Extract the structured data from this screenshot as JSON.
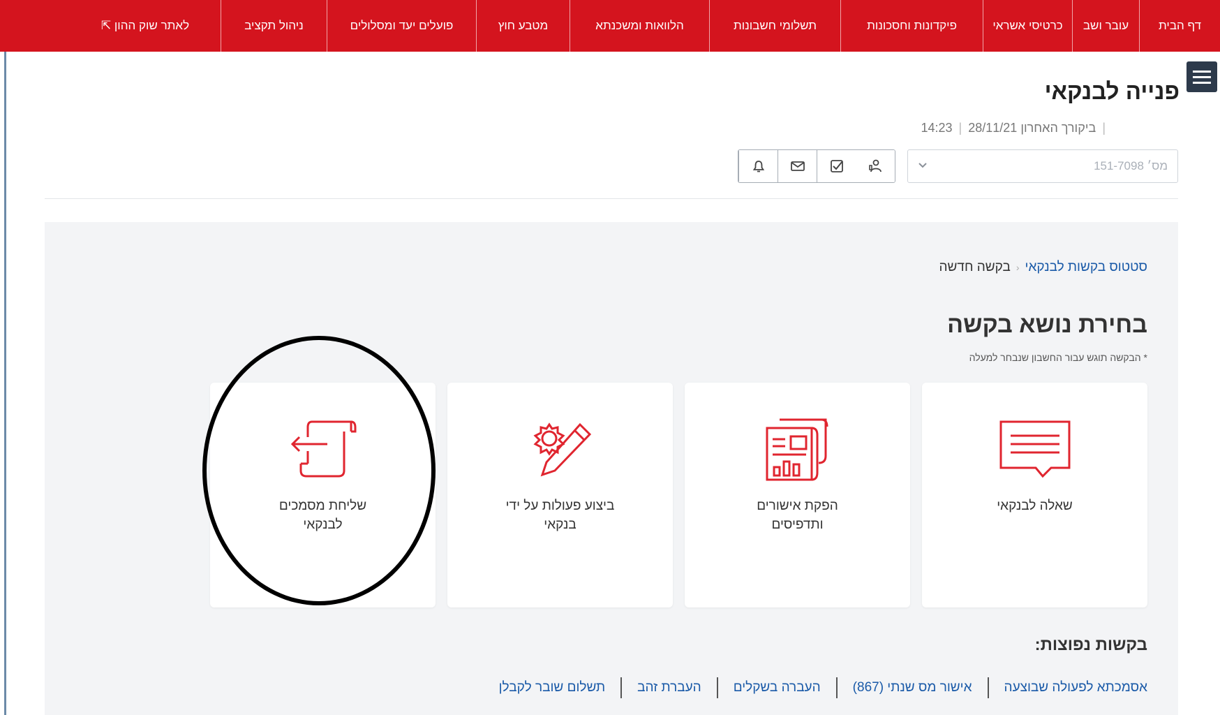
{
  "nav": {
    "items": [
      {
        "label": "דף הבית"
      },
      {
        "label": "עובר ושב"
      },
      {
        "label": "כרטיסי אשראי"
      },
      {
        "label": "פיקדונות וחסכונות"
      },
      {
        "label": "תשלומי חשבונות"
      },
      {
        "label": "הלוואות ומשכנתא"
      },
      {
        "label": "מטבע חוץ"
      },
      {
        "label": "פועלים יעד ומסלולים"
      },
      {
        "label": "ניהול תקציב"
      },
      {
        "label": "לאתר שוק ההון ⇱"
      }
    ]
  },
  "header": {
    "title": "פנייה לבנקאי",
    "last_visit_label": "ביקורך האחרון",
    "last_visit_date": "28/11/21",
    "last_visit_time": "14:23",
    "account_placeholder": "מס׳ 151-7098"
  },
  "icons": {
    "menu": "hamburger-icon",
    "chevron": "chevron-down-icon",
    "bell": "bell-icon",
    "mail": "mail-icon",
    "tasks": "checkbox-icon",
    "advisor": "person-icon"
  },
  "breadcrumb": {
    "parent": "סטטוס בקשות לבנקאי",
    "current": "בקשה חדשה"
  },
  "section": {
    "title": "בחירת נושא בקשה",
    "note": "* הבקשה תוגש עבור החשבון שנבחר למעלה"
  },
  "cards": [
    {
      "label": "שאלה לבנקאי",
      "icon": "chat-message-icon"
    },
    {
      "label": "הפקת אישורים ותדפיסים",
      "icon": "reports-document-icon"
    },
    {
      "label": "ביצוע פעולות על ידי בנקאי",
      "icon": "gear-pencil-icon"
    },
    {
      "label": "שליחת מסמכים לבנקאי",
      "icon": "send-document-icon"
    }
  ],
  "popular": {
    "title": "בקשות נפוצות:",
    "links": [
      "אסמכתא לפעולה שבוצעה",
      "אישור מס שנתי (867)",
      "העברה בשקלים",
      "העברת זהב",
      "תשלום שובר לקבלן"
    ]
  },
  "colors": {
    "brand_red": "#d4141e",
    "link_blue": "#1a5aa8",
    "panel_gray": "#f3f4f6"
  }
}
